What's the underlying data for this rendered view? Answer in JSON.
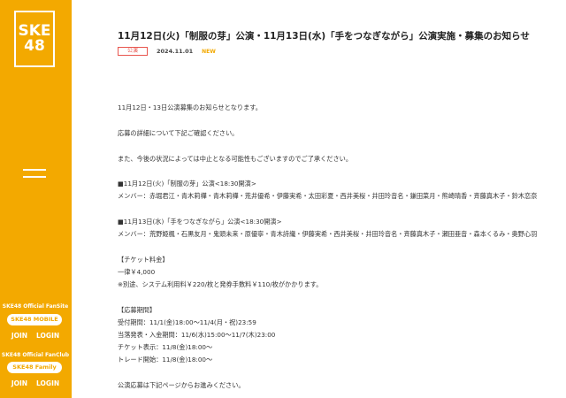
{
  "logo": {
    "line1": "SKE",
    "line2": "48"
  },
  "sidebar": {
    "fanclubs": [
      {
        "label": "SKE48 Official FanSite",
        "pill": "SKE48 MOBILE",
        "join": "JOIN",
        "login": "LOGIN"
      },
      {
        "label": "SKE48 Official FanClub",
        "pill": "SKE48 Family",
        "join": "JOIN",
        "login": "LOGIN"
      }
    ]
  },
  "article": {
    "title": "11月12日(火)「制服の芽」公演・11月13日(水)「手をつなぎながら」公演実施・募集のお知らせ",
    "tag": "公演",
    "date": "2024.11.01",
    "badge": "NEW",
    "lines": [
      "11月12日・13日公演募集のお知らせとなります。",
      "応募の詳細について下記ご確認ください。",
      "また、今後の状況によっては中止となる可能性もございますのでご了承ください。",
      "■11月12日(火)「制服の芽」公演<18:30開演>",
      "メンバー：赤堀君江・青木莉樺・青木莉樺・荒井優希・伊藤実希・太田彩夏・西井美桜・井田玲音名・鎌田菜月・熊崎晴香・斉藤真木子・鈴木恋奈",
      "■11月13日(水)「手をつなぎながら」公演<18:30開演>",
      "メンバー：荒野姫楓・石黒友月・鬼頭未来・原優寧・青木詩織・伊藤実希・西井美桜・井田玲音名・斉藤真木子・瀬田亜音・森本くるみ・奥野心羽",
      "【チケット料金】",
      "一律￥4,000",
      "※別途、システム利用料￥220/枚と発券手数料￥110/枚がかかります。",
      "【応募期間】",
      "受付期間：11/1(金)18:00～11/4(月・祝)23:59",
      "当落発表・入金期間：11/6(水)15:00～11/7(木)23:00",
      "チケット表示：11/8(金)18:00～",
      "トレード開始：11/8(金)18:00～",
      "公演応募は下記ページからお進みください。"
    ]
  }
}
